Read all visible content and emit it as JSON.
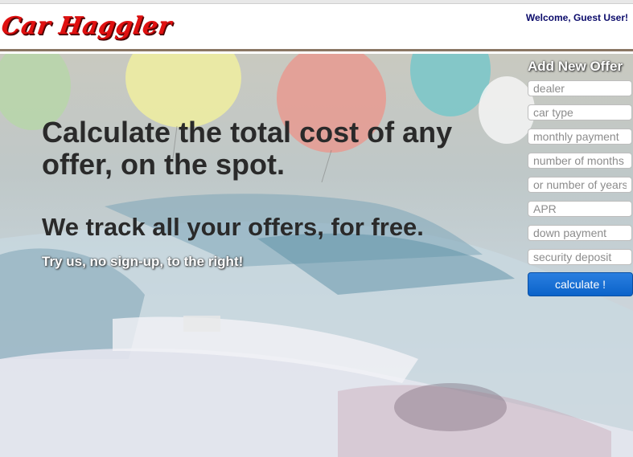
{
  "header": {
    "logo_text": "Car Haggler",
    "welcome_text": "Welcome, Guest User!"
  },
  "hero": {
    "headline": "Calculate the total cost of any offer, on the spot.",
    "subheadline": "We track all your offers, for free.",
    "cta_text": "Try us, no sign-up, to the right!"
  },
  "offer_form": {
    "title": "Add New Offer",
    "fields": {
      "dealer": "dealer",
      "car_type": "car type",
      "monthly_payment": "monthly payment",
      "number_of_months": "number of months",
      "number_of_years": "or number of years",
      "apr": "APR",
      "down_payment": "down payment",
      "security_deposit": "security deposit"
    },
    "submit_label": "calculate !"
  },
  "colors": {
    "logo_red": "#e01010",
    "welcome_navy": "#0b0b6b",
    "button_blue": "#0b63c9",
    "header_border": "#8a7664"
  }
}
